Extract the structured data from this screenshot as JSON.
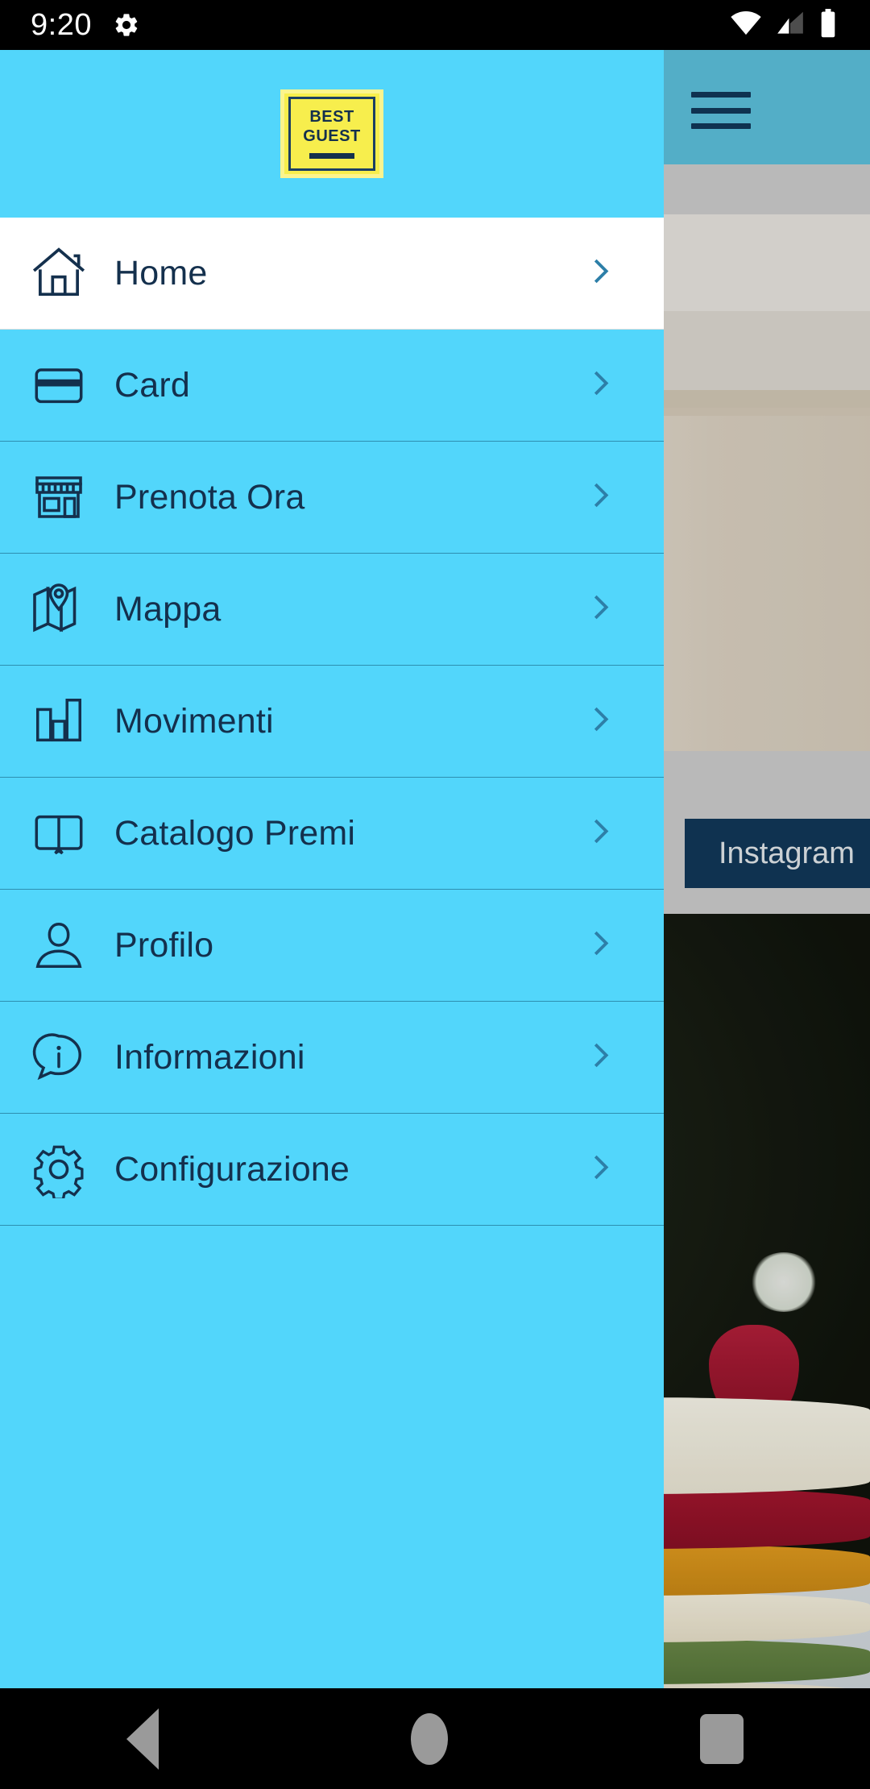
{
  "status_bar": {
    "time": "9:20",
    "icons": [
      "gear-icon",
      "wifi-icon",
      "cellular-signal-icon",
      "battery-icon"
    ]
  },
  "drawer": {
    "logo": {
      "line1": "BEST",
      "line2": "GUEST",
      "bg_color": "#f7ee4d",
      "text_color": "#14304d"
    },
    "background_color": "#52d6fb",
    "active_item_background": "#ffffff",
    "items": [
      {
        "label": "Home",
        "icon": "house-icon",
        "active": true
      },
      {
        "label": "Card",
        "icon": "credit-card-icon",
        "active": false
      },
      {
        "label": "Prenota Ora",
        "icon": "storefront-icon",
        "active": false
      },
      {
        "label": "Mappa",
        "icon": "map-pin-icon",
        "active": false
      },
      {
        "label": "Movimenti",
        "icon": "bar-chart-icon",
        "active": false
      },
      {
        "label": "Catalogo Premi",
        "icon": "open-book-icon",
        "active": false
      },
      {
        "label": "Profilo",
        "icon": "person-icon",
        "active": false
      },
      {
        "label": "Informazioni",
        "icon": "info-bubble-icon",
        "active": false
      },
      {
        "label": "Configurazione",
        "icon": "gear-icon",
        "active": false
      }
    ],
    "chevron_icon": "chevron-right-icon"
  },
  "content": {
    "header": {
      "menu_icon": "hamburger-menu-icon",
      "background_color": "#5fc7e3"
    },
    "hero_image_alt": "hotel-room-wardrobe-photo",
    "instagram_button": {
      "label": "Instagram",
      "background_color": "#123a5c",
      "text_color": "#e9eef2"
    },
    "second_image_alt": "layered-cake-dessert-photo"
  },
  "navigation_bar": {
    "back": "back-triangle-icon",
    "home": "home-circle-icon",
    "recents": "recents-square-icon"
  }
}
